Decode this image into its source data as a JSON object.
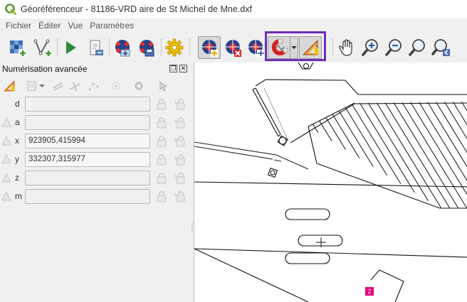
{
  "window": {
    "title": "Géoréférenceur - 81186-VRD aire de St Michel de Mne.dxf"
  },
  "menu": [
    "Fichier",
    "Éditer",
    "Vue",
    "Paramètres"
  ],
  "toolbar": {
    "buttons": [
      "add-raster",
      "add-vector",
      "start-georeferencing",
      "generate-gdal-script",
      "load-gcp-points",
      "save-gcp-points",
      "transformation-settings",
      "add-point",
      "delete-point",
      "move-gcp-point",
      "snapping",
      "advanced-digitizing",
      "pan",
      "zoom-in",
      "zoom-out",
      "zoom-to-layer",
      "zoom-last"
    ],
    "highlight_color": "#6d2fb8"
  },
  "panel": {
    "title": "Numérisation avancée",
    "fields": [
      {
        "key": "d",
        "value": ""
      },
      {
        "key": "a",
        "value": ""
      },
      {
        "key": "x",
        "value": "923905,415994"
      },
      {
        "key": "y",
        "value": "332307,315977"
      },
      {
        "key": "z",
        "value": ""
      },
      {
        "key": "m",
        "value": ""
      }
    ]
  },
  "canvas": {
    "marker_label": "2",
    "marker_color": "#e6007e"
  }
}
